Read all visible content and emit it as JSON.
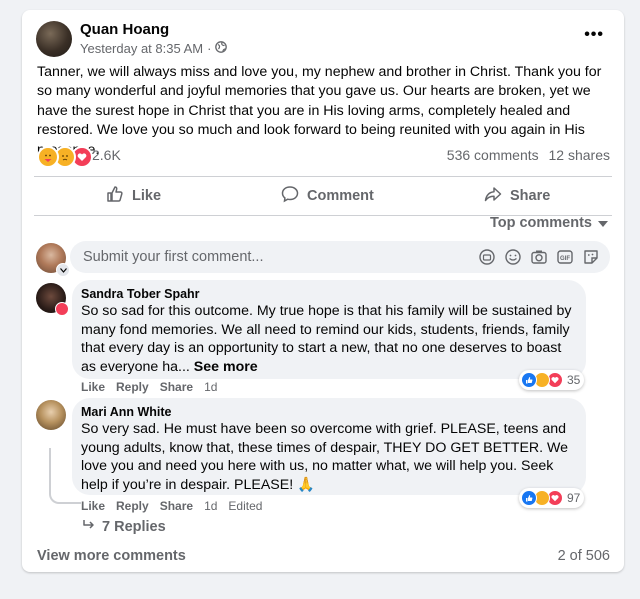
{
  "post": {
    "author": "Quan Hoang",
    "timestamp": "Yesterday at 8:35 AM",
    "separator": "·",
    "privacy_icon": "globe-icon",
    "more_icon": "•••",
    "text": "Tanner, we will always miss and love you, my nephew and brother in Christ. Thank you for so many wonderful and joyful memories that you gave us.  Our hearts are broken, yet we have the surest hope in Christ that you are in His loving arms, completely healed  and restored.  We love you so much and look forward to being reunited with you again in His presence.",
    "reaction_count": "2.6K",
    "comments_count": "536 comments",
    "shares_count": "12 shares",
    "reaction_icons": [
      "care-emoji",
      "sad-emoji",
      "love-emoji"
    ]
  },
  "actions": {
    "like": "Like",
    "comment": "Comment",
    "share": "Share"
  },
  "comments_section": {
    "sort_label": "Top comments",
    "input_placeholder": "Submit your first comment...",
    "input_icons": [
      "sticker-icon",
      "emoji-icon",
      "camera-icon",
      "gif-icon",
      "sticker-smile-icon"
    ],
    "comments": [
      {
        "author": "Sandra Tober Spahr",
        "text": "So so sad for this outcome. My true hope is that his family will be sustained by many fond memories. We all need to remind our kids, students, friends, family that every day is an opportunity to start a new, that no one deserves to boast as everyone ha...",
        "see_more": "See more",
        "like": "Like",
        "reply": "Reply",
        "share": "Share",
        "time": "1d",
        "reactions": "35"
      },
      {
        "author": "Mari Ann White",
        "text": "So very sad. He must have been so overcome with grief. PLEASE, teens and young adults, know that, these times of despair, THEY DO GET BETTER. We love you and need you here with us, no matter what, we will help you. Seek help if you’re in despair. PLEASE! 🙏",
        "like": "Like",
        "reply": "Reply",
        "share": "Share",
        "time": "1d",
        "edited": "Edited",
        "reactions": "97",
        "replies_label": "7 Replies"
      }
    ],
    "view_more": "View more comments",
    "pager": "2 of 506"
  },
  "colors": {
    "background": "#f0f2f5",
    "card": "#ffffff",
    "text": "#050505",
    "secondary": "#65676b",
    "like_blue": "#1877f2",
    "love_red": "#f33e58",
    "care_yellow": "#f7b125"
  }
}
